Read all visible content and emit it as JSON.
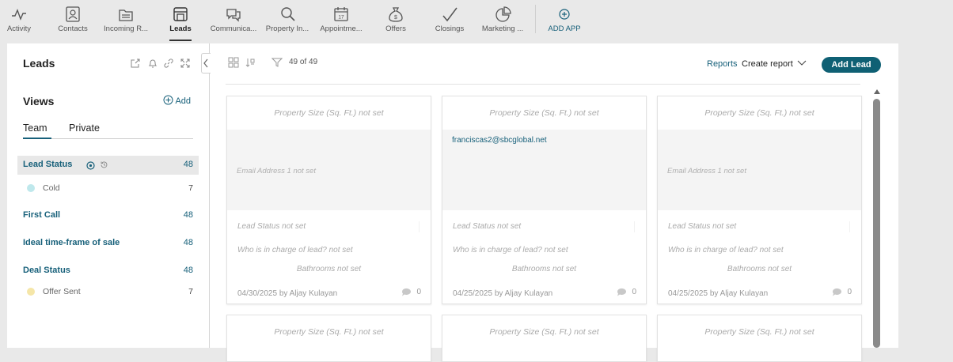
{
  "nav": {
    "items": [
      {
        "label": "Activity",
        "icon": "activity-icon"
      },
      {
        "label": "Contacts",
        "icon": "contacts-icon"
      },
      {
        "label": "Incoming R...",
        "icon": "incoming-icon"
      },
      {
        "label": "Leads",
        "icon": "leads-icon",
        "active": true
      },
      {
        "label": "Communica...",
        "icon": "communications-icon"
      },
      {
        "label": "Property In...",
        "icon": "search-icon"
      },
      {
        "label": "Appointme...",
        "icon": "calendar-icon"
      },
      {
        "label": "Offers",
        "icon": "money-bag-icon"
      },
      {
        "label": "Closings",
        "icon": "checkmark-icon"
      },
      {
        "label": "Marketing ...",
        "icon": "pie-chart-icon"
      }
    ],
    "add_app": "ADD APP"
  },
  "left": {
    "title": "Leads",
    "views_title": "Views",
    "add_label": "Add",
    "tabs": [
      "Team",
      "Private"
    ],
    "views": [
      {
        "name": "Lead Status",
        "count": "48",
        "sub": [
          {
            "name": "Cold",
            "count": "7",
            "color": "#bfe8ec"
          }
        ]
      },
      {
        "name": "First Call",
        "count": "48"
      },
      {
        "name": "Ideal time-frame of sale",
        "count": "48"
      },
      {
        "name": "Deal Status",
        "count": "48",
        "sub": [
          {
            "name": "Offer Sent",
            "count": "7",
            "color": "#f5e6a8"
          }
        ]
      }
    ]
  },
  "toolbar": {
    "count": "49 of 49",
    "reports": "Reports",
    "create_report": "Create report",
    "add_lead": "Add Lead"
  },
  "cards": [
    {
      "property": "Property Size (Sq. Ft.) not set",
      "email": "Email Address 1 not set",
      "email_set": false,
      "lead_status": "Lead Status not set",
      "in_charge": "Who is in charge of lead? not set",
      "bathrooms": "Bathrooms not set",
      "footer": "04/30/2025 by Aljay Kulayan",
      "comments": "0"
    },
    {
      "property": "Property Size (Sq. Ft.) not set",
      "email": "franciscas2@sbcglobal.net",
      "email_set": true,
      "lead_status": "Lead Status not set",
      "in_charge": "Who is in charge of lead? not set",
      "bathrooms": "Bathrooms not set",
      "footer": "04/25/2025 by Aljay Kulayan",
      "comments": "0"
    },
    {
      "property": "Property Size (Sq. Ft.) not set",
      "email": "Email Address 1 not set",
      "email_set": false,
      "lead_status": "Lead Status not set",
      "in_charge": "Who is in charge of lead? not set",
      "bathrooms": "Bathrooms not set",
      "footer": "04/25/2025 by Aljay Kulayan",
      "comments": "0"
    }
  ],
  "cards_row2": [
    {
      "property": "Property Size (Sq. Ft.) not set"
    },
    {
      "property": "Property Size (Sq. Ft.) not set"
    },
    {
      "property": "Property Size (Sq. Ft.) not set"
    }
  ],
  "colors": {
    "accent": "#17607a",
    "add_lead_bg": "#0f6074",
    "active_row_bg": "#e8e8e8"
  }
}
